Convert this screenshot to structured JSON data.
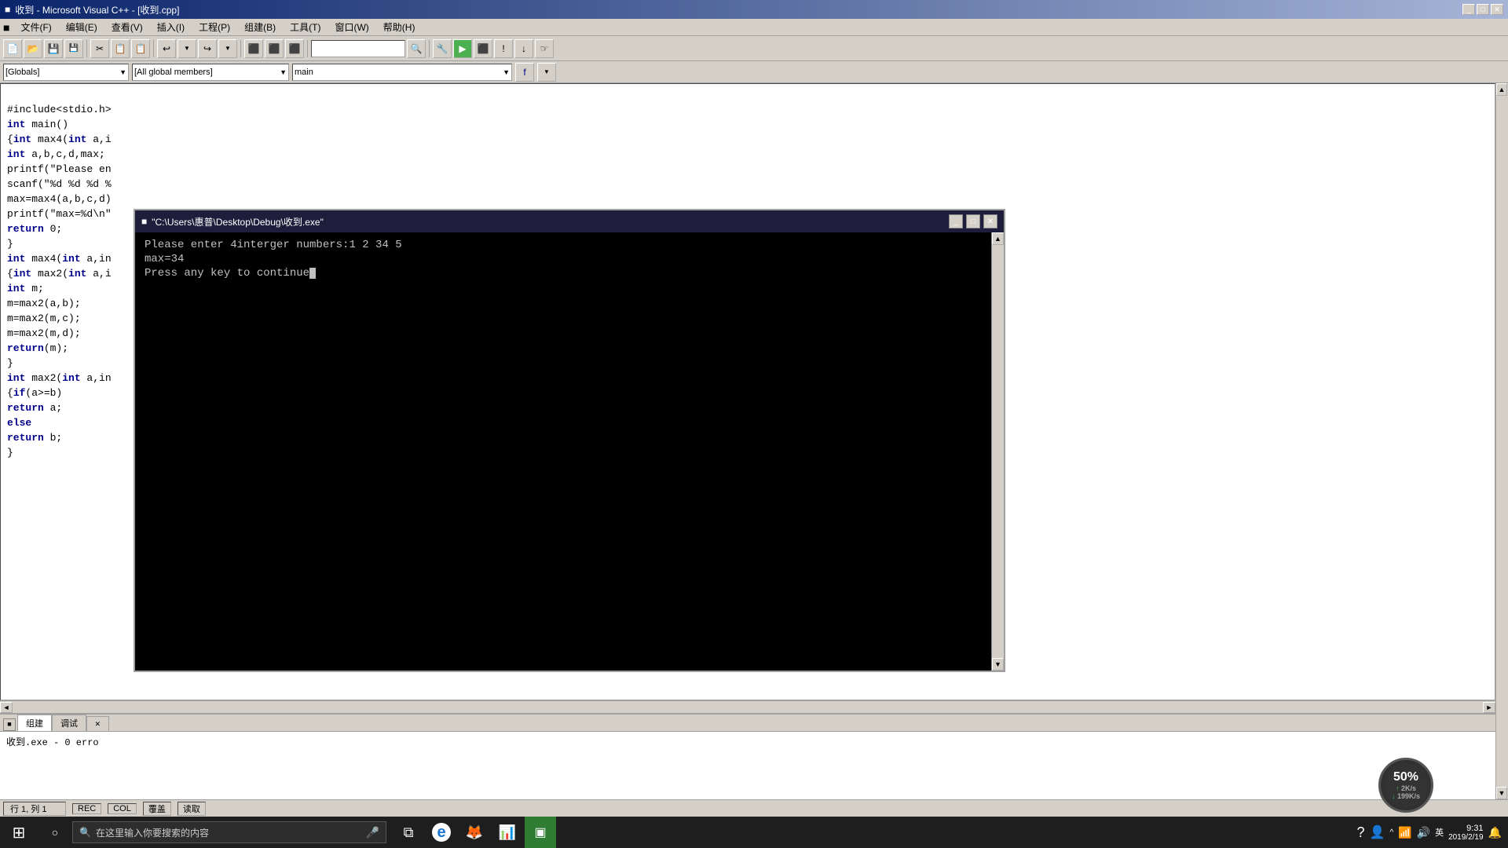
{
  "titlebar": {
    "icon": "■",
    "title": "收到 - Microsoft Visual C++ - [收到.cpp]",
    "min": "_",
    "max": "□",
    "close": "✕"
  },
  "menubar": {
    "items": [
      "文件(F)",
      "编辑(E)",
      "查看(V)",
      "插入(I)",
      "工程(P)",
      "组建(B)",
      "工具(T)",
      "窗口(W)",
      "帮助(H)"
    ]
  },
  "toolbar1": {
    "buttons": [
      "📄",
      "📂",
      "💾",
      "🖨",
      "✂",
      "📋",
      "📋",
      "↩",
      "↩",
      "⬛",
      "⬛",
      "⬛",
      "🔍",
      "🔧"
    ]
  },
  "toolbar2": {
    "globals": "[Globals]",
    "members": "[All global members]",
    "function": "main"
  },
  "code": {
    "lines": [
      {
        "text": "#include<stdio.h>",
        "type": "normal"
      },
      {
        "text": "int main()",
        "type": "mixed"
      },
      {
        "text": "{int max4(int a,i",
        "type": "mixed"
      },
      {
        "text": "int a,b,c,d,max;",
        "type": "mixed"
      },
      {
        "text": "printf(\"Please en",
        "type": "mixed"
      },
      {
        "text": "scanf(\"%d %d %d %",
        "type": "mixed"
      },
      {
        "text": "max=max4(a,b,c,d)",
        "type": "normal"
      },
      {
        "text": "printf(\"max=%d\\n\"",
        "type": "mixed"
      },
      {
        "text": "return 0;",
        "type": "mixed"
      },
      {
        "text": "}",
        "type": "normal"
      },
      {
        "text": "int max4(int a,in",
        "type": "mixed"
      },
      {
        "text": "{int max2(int a,i",
        "type": "mixed"
      },
      {
        "text": "int m;",
        "type": "mixed"
      },
      {
        "text": "m=max2(a,b);",
        "type": "normal"
      },
      {
        "text": "m=max2(m,c);",
        "type": "normal"
      },
      {
        "text": "m=max2(m,d);",
        "type": "normal"
      },
      {
        "text": "return(m);",
        "type": "mixed"
      },
      {
        "text": "}",
        "type": "normal"
      },
      {
        "text": "int max2(int a,in",
        "type": "mixed"
      },
      {
        "text": "{if(a>=b)",
        "type": "mixed"
      },
      {
        "text": "return a;",
        "type": "mixed"
      },
      {
        "text": "else",
        "type": "mixed"
      },
      {
        "text": "return b;",
        "type": "mixed"
      },
      {
        "text": "}",
        "type": "normal"
      }
    ]
  },
  "console": {
    "title": "\"C:\\Users\\惠普\\Desktop\\Debug\\收到.exe\"",
    "line1": "Please enter 4interger numbers:1 2 34 5",
    "line2": "max=34",
    "line3": "Press any key to continue",
    "cursor": "_"
  },
  "bottom": {
    "output_text": "收到.exe - 0 erro",
    "tabs": [
      "组建",
      "调试",
      "✕"
    ]
  },
  "statusbar": {
    "position": "行 1, 列 1",
    "rec": "REC",
    "col": "COL",
    "cover": "覆盖",
    "read": "读取"
  },
  "taskbar": {
    "start_icon": "⊞",
    "search_placeholder": "在这里输入你要搜索的内容",
    "mic_icon": "🎤",
    "taskview_icon": "⧉",
    "ie_icon": "e",
    "app1": "🦊",
    "app2": "📊",
    "time": "9:31",
    "date": "2019/2/19",
    "network_pct": "50%",
    "net_up": "2K/s",
    "net_down": "199K/s"
  }
}
